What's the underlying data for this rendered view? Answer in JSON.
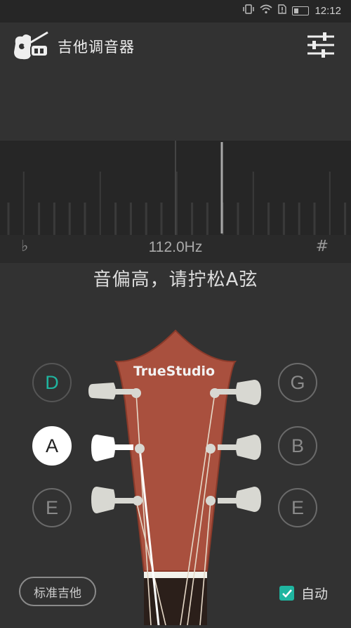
{
  "status_bar": {
    "time": "12:12"
  },
  "app": {
    "title": "吉他调音器"
  },
  "tuner": {
    "flat_symbol": "♭",
    "sharp_symbol": "#",
    "frequency": "112.0Hz",
    "message": "音偏高，请拧松A弦"
  },
  "strings": {
    "left": [
      {
        "note": "D",
        "state": "tuned"
      },
      {
        "note": "A",
        "state": "active"
      },
      {
        "note": "E",
        "state": "idle"
      }
    ],
    "right": [
      {
        "note": "G",
        "state": "idle"
      },
      {
        "note": "B",
        "state": "idle"
      },
      {
        "note": "E",
        "state": "idle"
      }
    ]
  },
  "headstock": {
    "brand": "TrueStudio"
  },
  "bottom": {
    "preset_label": "标准吉他",
    "auto_label": "自动",
    "auto_checked": true
  },
  "colors": {
    "background": "#323232",
    "accent": "#1fb5a0",
    "headstock": "#a9503e",
    "peg": "#d8d8d2"
  }
}
